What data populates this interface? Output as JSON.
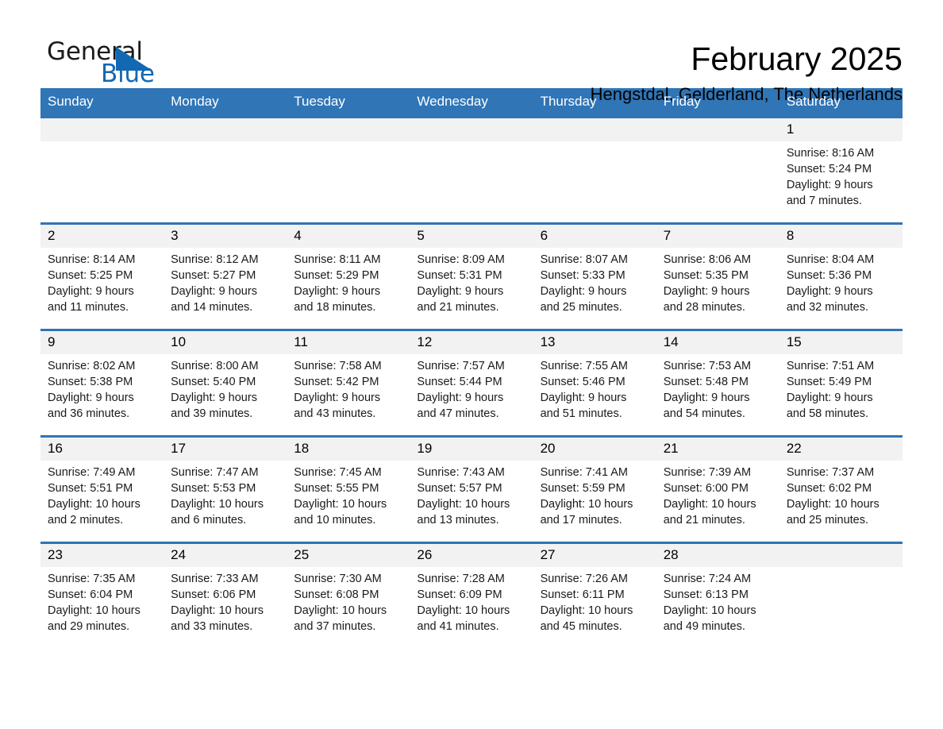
{
  "brand": {
    "name_part1": "General",
    "name_part2": "Blue",
    "accent_color": "#1268b3"
  },
  "header": {
    "title": "February 2025",
    "subtitle": "Hengstdal, Gelderland, The Netherlands"
  },
  "theme": {
    "header_bar_color": "#3075b6",
    "row_border_color": "#2e74b5",
    "daynum_band_color": "#f2f2f2"
  },
  "weekdays": [
    "Sunday",
    "Monday",
    "Tuesday",
    "Wednesday",
    "Thursday",
    "Friday",
    "Saturday"
  ],
  "weeks": [
    [
      {
        "day": "",
        "lines": []
      },
      {
        "day": "",
        "lines": []
      },
      {
        "day": "",
        "lines": []
      },
      {
        "day": "",
        "lines": []
      },
      {
        "day": "",
        "lines": []
      },
      {
        "day": "",
        "lines": []
      },
      {
        "day": "1",
        "lines": [
          "Sunrise: 8:16 AM",
          "Sunset: 5:24 PM",
          "Daylight: 9 hours",
          "and 7 minutes."
        ]
      }
    ],
    [
      {
        "day": "2",
        "lines": [
          "Sunrise: 8:14 AM",
          "Sunset: 5:25 PM",
          "Daylight: 9 hours",
          "and 11 minutes."
        ]
      },
      {
        "day": "3",
        "lines": [
          "Sunrise: 8:12 AM",
          "Sunset: 5:27 PM",
          "Daylight: 9 hours",
          "and 14 minutes."
        ]
      },
      {
        "day": "4",
        "lines": [
          "Sunrise: 8:11 AM",
          "Sunset: 5:29 PM",
          "Daylight: 9 hours",
          "and 18 minutes."
        ]
      },
      {
        "day": "5",
        "lines": [
          "Sunrise: 8:09 AM",
          "Sunset: 5:31 PM",
          "Daylight: 9 hours",
          "and 21 minutes."
        ]
      },
      {
        "day": "6",
        "lines": [
          "Sunrise: 8:07 AM",
          "Sunset: 5:33 PM",
          "Daylight: 9 hours",
          "and 25 minutes."
        ]
      },
      {
        "day": "7",
        "lines": [
          "Sunrise: 8:06 AM",
          "Sunset: 5:35 PM",
          "Daylight: 9 hours",
          "and 28 minutes."
        ]
      },
      {
        "day": "8",
        "lines": [
          "Sunrise: 8:04 AM",
          "Sunset: 5:36 PM",
          "Daylight: 9 hours",
          "and 32 minutes."
        ]
      }
    ],
    [
      {
        "day": "9",
        "lines": [
          "Sunrise: 8:02 AM",
          "Sunset: 5:38 PM",
          "Daylight: 9 hours",
          "and 36 minutes."
        ]
      },
      {
        "day": "10",
        "lines": [
          "Sunrise: 8:00 AM",
          "Sunset: 5:40 PM",
          "Daylight: 9 hours",
          "and 39 minutes."
        ]
      },
      {
        "day": "11",
        "lines": [
          "Sunrise: 7:58 AM",
          "Sunset: 5:42 PM",
          "Daylight: 9 hours",
          "and 43 minutes."
        ]
      },
      {
        "day": "12",
        "lines": [
          "Sunrise: 7:57 AM",
          "Sunset: 5:44 PM",
          "Daylight: 9 hours",
          "and 47 minutes."
        ]
      },
      {
        "day": "13",
        "lines": [
          "Sunrise: 7:55 AM",
          "Sunset: 5:46 PM",
          "Daylight: 9 hours",
          "and 51 minutes."
        ]
      },
      {
        "day": "14",
        "lines": [
          "Sunrise: 7:53 AM",
          "Sunset: 5:48 PM",
          "Daylight: 9 hours",
          "and 54 minutes."
        ]
      },
      {
        "day": "15",
        "lines": [
          "Sunrise: 7:51 AM",
          "Sunset: 5:49 PM",
          "Daylight: 9 hours",
          "and 58 minutes."
        ]
      }
    ],
    [
      {
        "day": "16",
        "lines": [
          "Sunrise: 7:49 AM",
          "Sunset: 5:51 PM",
          "Daylight: 10 hours",
          "and 2 minutes."
        ]
      },
      {
        "day": "17",
        "lines": [
          "Sunrise: 7:47 AM",
          "Sunset: 5:53 PM",
          "Daylight: 10 hours",
          "and 6 minutes."
        ]
      },
      {
        "day": "18",
        "lines": [
          "Sunrise: 7:45 AM",
          "Sunset: 5:55 PM",
          "Daylight: 10 hours",
          "and 10 minutes."
        ]
      },
      {
        "day": "19",
        "lines": [
          "Sunrise: 7:43 AM",
          "Sunset: 5:57 PM",
          "Daylight: 10 hours",
          "and 13 minutes."
        ]
      },
      {
        "day": "20",
        "lines": [
          "Sunrise: 7:41 AM",
          "Sunset: 5:59 PM",
          "Daylight: 10 hours",
          "and 17 minutes."
        ]
      },
      {
        "day": "21",
        "lines": [
          "Sunrise: 7:39 AM",
          "Sunset: 6:00 PM",
          "Daylight: 10 hours",
          "and 21 minutes."
        ]
      },
      {
        "day": "22",
        "lines": [
          "Sunrise: 7:37 AM",
          "Sunset: 6:02 PM",
          "Daylight: 10 hours",
          "and 25 minutes."
        ]
      }
    ],
    [
      {
        "day": "23",
        "lines": [
          "Sunrise: 7:35 AM",
          "Sunset: 6:04 PM",
          "Daylight: 10 hours",
          "and 29 minutes."
        ]
      },
      {
        "day": "24",
        "lines": [
          "Sunrise: 7:33 AM",
          "Sunset: 6:06 PM",
          "Daylight: 10 hours",
          "and 33 minutes."
        ]
      },
      {
        "day": "25",
        "lines": [
          "Sunrise: 7:30 AM",
          "Sunset: 6:08 PM",
          "Daylight: 10 hours",
          "and 37 minutes."
        ]
      },
      {
        "day": "26",
        "lines": [
          "Sunrise: 7:28 AM",
          "Sunset: 6:09 PM",
          "Daylight: 10 hours",
          "and 41 minutes."
        ]
      },
      {
        "day": "27",
        "lines": [
          "Sunrise: 7:26 AM",
          "Sunset: 6:11 PM",
          "Daylight: 10 hours",
          "and 45 minutes."
        ]
      },
      {
        "day": "28",
        "lines": [
          "Sunrise: 7:24 AM",
          "Sunset: 6:13 PM",
          "Daylight: 10 hours",
          "and 49 minutes."
        ]
      },
      {
        "day": "",
        "lines": []
      }
    ]
  ]
}
